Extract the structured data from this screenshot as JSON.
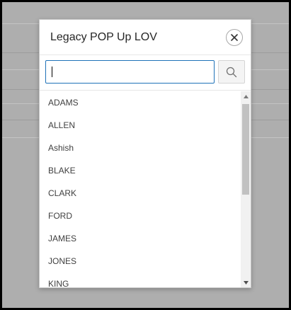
{
  "dialog": {
    "title": "Legacy POP Up LOV",
    "close_icon": "close-icon"
  },
  "search": {
    "value": "",
    "button_icon": "search-icon"
  },
  "list": {
    "items": [
      "ADAMS",
      "ALLEN",
      "Ashish",
      "BLAKE",
      "CLARK",
      "FORD",
      "JAMES",
      "JONES",
      "KING"
    ]
  },
  "colors": {
    "overlay": "#aeaeae",
    "input_border": "#1f72b8",
    "text": "#404040"
  }
}
